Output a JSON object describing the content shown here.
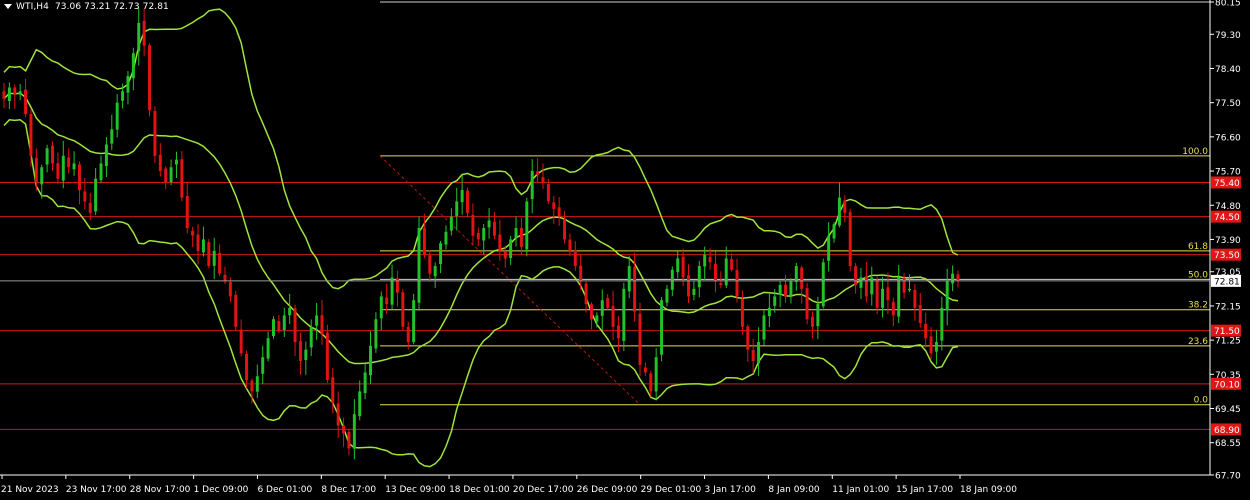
{
  "header": {
    "symbol": "WTI,H4",
    "ohlc": "73.06 73.21 72.73 72.81"
  },
  "colors": {
    "background": "#000000",
    "bull": "#22c32a",
    "bear": "#e31313",
    "bands": "#9fe43a",
    "fib_line": "#e6e04a",
    "level_line": "#cc1a1a",
    "level_tag_bg": "#e01515",
    "price_tag_bg": "#ffffff",
    "axis_line": "#ffffff"
  },
  "chart_data": {
    "type": "candlestick",
    "timeframe": "H4",
    "y_range": [
      67.7,
      80.15
    ],
    "y_ticks": [
      "80.15",
      "79.30",
      "78.40",
      "77.50",
      "76.60",
      "75.70",
      "74.80",
      "73.90",
      "73.05",
      "72.15",
      "71.25",
      "70.35",
      "69.45",
      "68.55",
      "67.70"
    ],
    "x_ticks": [
      "21 Nov 2023",
      "23 Nov 17:00",
      "28 Nov 17:00",
      "1 Dec 09:00",
      "6 Dec 01:00",
      "8 Dec 17:00",
      "13 Dec 09:00",
      "18 Dec 01:00",
      "20 Dec 17:00",
      "26 Dec 09:00",
      "29 Dec 01:00",
      "3 Jan 17:00",
      "8 Jan 09:00",
      "11 Jan 01:00",
      "15 Jan 17:00",
      "18 Jan 09:00"
    ],
    "current_price": "72.81",
    "support_resistance": [
      {
        "price": 75.4,
        "label": "75.40"
      },
      {
        "price": 74.5,
        "label": "74.50"
      },
      {
        "price": 73.5,
        "label": "73.50"
      },
      {
        "price": 71.5,
        "label": "71.50"
      },
      {
        "price": 70.1,
        "label": "70.10"
      },
      {
        "price": 68.9,
        "label": "68.90"
      }
    ],
    "fibonacci": [
      {
        "level": "100.0",
        "price": 76.1
      },
      {
        "level": "61.8",
        "price": 73.6
      },
      {
        "level": "50.0",
        "price": 72.85
      },
      {
        "level": "38.2",
        "price": 72.05
      },
      {
        "level": "23.6",
        "price": 71.1
      },
      {
        "level": "0.0",
        "price": 69.55
      }
    ],
    "series_close": [
      77.6,
      77.9,
      77.7,
      77.8,
      77.2,
      76.1,
      75.4,
      75.8,
      76.3,
      75.9,
      75.5,
      76.1,
      75.8,
      75.9,
      75.2,
      74.9,
      74.6,
      75.5,
      75.9,
      76.4,
      76.8,
      77.5,
      77.8,
      78.2,
      78.8,
      79.6,
      79.0,
      77.3,
      76.1,
      75.7,
      75.4,
      75.8,
      76.0,
      75.0,
      74.2,
      74.0,
      73.6,
      73.9,
      73.2,
      73.6,
      73.0,
      72.8,
      72.4,
      71.6,
      70.9,
      70.2,
      69.9,
      70.3,
      70.8,
      71.3,
      71.8,
      71.5,
      71.9,
      72.1,
      71.2,
      70.7,
      71.0,
      71.6,
      71.9,
      71.4,
      70.2,
      69.6,
      69.0,
      68.8,
      68.4,
      69.3,
      69.9,
      70.4,
      71.1,
      71.8,
      72.4,
      72.2,
      72.9,
      72.5,
      71.6,
      71.2,
      72.3,
      74.2,
      73.5,
      73.0,
      73.2,
      73.8,
      74.1,
      74.5,
      74.9,
      75.2,
      74.6,
      74.0,
      73.9,
      74.2,
      74.4,
      74.0,
      73.6,
      73.4,
      73.9,
      74.2,
      73.7,
      74.9,
      75.7,
      75.6,
      75.4,
      74.9,
      74.7,
      74.5,
      73.9,
      73.6,
      73.2,
      72.8,
      72.2,
      71.8,
      71.9,
      72.3,
      72.1,
      71.6,
      71.3,
      72.6,
      73.2,
      72.0,
      70.6,
      70.4,
      69.9,
      70.8,
      72.3,
      72.6,
      73.1,
      73.4,
      72.9,
      72.4,
      72.6,
      73.2,
      73.5,
      73.3,
      72.8,
      72.7,
      73.4,
      73.1,
      72.4,
      71.6,
      71.0,
      70.7,
      71.2,
      71.9,
      72.1,
      72.4,
      72.7,
      72.4,
      72.8,
      73.2,
      72.6,
      71.8,
      71.6,
      72.2,
      73.3,
      74.0,
      74.3,
      75.0,
      74.6,
      73.2,
      72.7,
      72.9,
      72.4,
      72.9,
      72.1,
      72.6,
      72.3,
      71.9,
      72.9,
      72.5,
      72.6,
      72.1,
      71.7,
      71.3,
      70.9,
      71.2,
      72.1,
      72.8,
      73.0,
      72.81
    ]
  }
}
